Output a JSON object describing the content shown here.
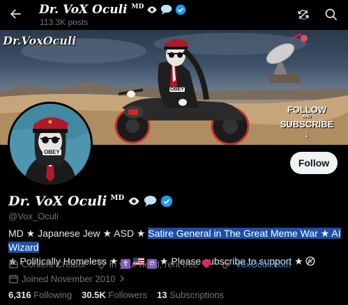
{
  "header": {
    "name": "Dr. VoX Oculi",
    "name_superscript": "MD",
    "posts": "113.3K posts"
  },
  "banner": {
    "title": "Dr.VoxOculi",
    "cta_line1": "FOLLOW",
    "cta_line2": "AND",
    "cta_line3": "SUBSCRIBE",
    "cta_arrow": "↓",
    "cap_text": "OBEY"
  },
  "avatar": {
    "cap_text": "OBEY"
  },
  "actions": {
    "follow_label": "Follow"
  },
  "profile": {
    "name": "Dr. VoX Oculi",
    "name_superscript": "MD",
    "handle": "@Vox_Oculi",
    "bio_part1": "MD ★ Japanese Jew ★ ASD ★ ",
    "bio_highlight": "Satire General in The Great Meme War ★ AI Wizard",
    "bio_part2": "★ Politically Homeless ★ ",
    "bio_part3": " ★ Please subscribe to support ★ ",
    "cross_glyph": "✝",
    "star_glyph": "✡",
    "meta": {
      "category": "Content Creator",
      "location": "In your head, rent free",
      "website": "VoxOculi.com",
      "joined": "Joined November 2010"
    }
  },
  "stats": {
    "following_count": "6,316",
    "following_label": "Following",
    "followers_count": "30.5K",
    "followers_label": "Followers",
    "subscriptions_count": "13",
    "subscriptions_label": "Subscriptions"
  },
  "colors": {
    "accent": "#1d9bf0",
    "verified": "#1d9bf0",
    "highlight": "#1d4fa8",
    "background": "#000000"
  }
}
